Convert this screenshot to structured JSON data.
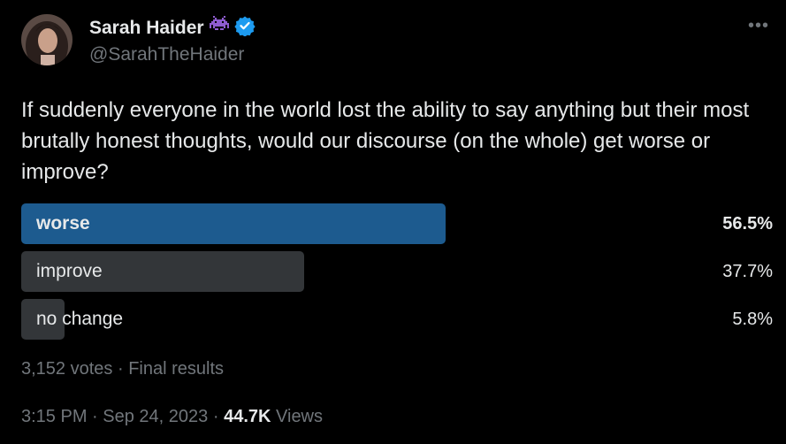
{
  "author": {
    "display_name": "Sarah Haider",
    "handle": "@SarahTheHaider",
    "emoji_icon": "space-invader-icon",
    "verified_icon": "verified-badge-icon"
  },
  "menu": {
    "more_label": "•••"
  },
  "tweet": {
    "text": "If suddenly everyone in the world lost the ability to say anything but their most brutally honest thoughts, would our discourse (on the whole) get worse or improve?"
  },
  "poll": {
    "options": [
      {
        "label": "worse",
        "percent": "56.5%",
        "fraction": 0.565,
        "winner": true
      },
      {
        "label": "improve",
        "percent": "37.7%",
        "fraction": 0.377,
        "winner": false
      },
      {
        "label": "no change",
        "percent": "5.8%",
        "fraction": 0.058,
        "winner": false
      }
    ],
    "votes": "3,152 votes",
    "separator": "·",
    "status": "Final results"
  },
  "meta": {
    "time": "3:15 PM",
    "sep1": "·",
    "date": "Sep 24, 2023",
    "sep2": "·",
    "views_count": "44.7K",
    "views_label": "Views"
  },
  "colors": {
    "winner_bar": "#1d5b8f",
    "other_bar": "#333639",
    "accent": "#1d9bf0",
    "secondary_text": "#71767b"
  }
}
